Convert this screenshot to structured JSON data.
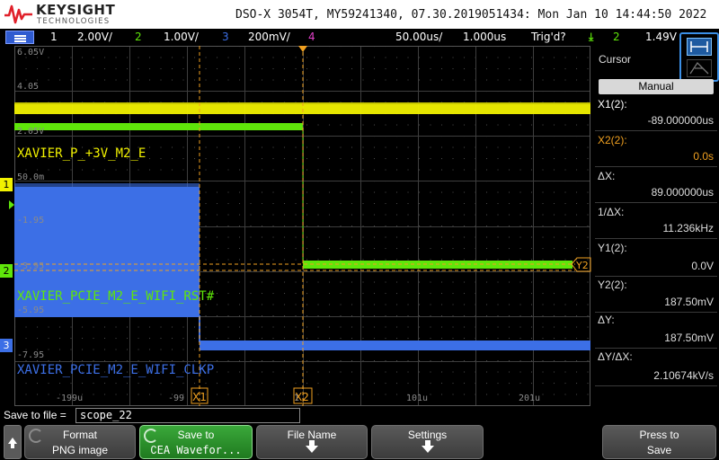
{
  "header": {
    "brand": "KEYSIGHT",
    "brand_sub": "TECHNOLOGIES",
    "instrument_line": "DSO-X 3054T, MY59241340, 07.30.2019051434: Mon Jan 10 14:44:50 2022"
  },
  "status_bar": {
    "ch1_num": "1",
    "ch1_scale": "2.00V/",
    "ch2_num": "2",
    "ch2_scale": "1.00V/",
    "ch3_num": "3",
    "ch3_scale": "200mV/",
    "ch4_num": "4",
    "timebase": "50.00us/",
    "delay": "1.000us",
    "trigger_state": "Trig'd?",
    "trigger_channel": "2",
    "trigger_level": "1.49V"
  },
  "waveforms": {
    "ch1_label": "XAVIER_P_+3V_M2_E",
    "ch2_label": "XAVIER_PCIE_M2_E_WIFI_RST#",
    "ch3_label": "XAVIER_PCIE_M2_E_WIFI_CLKP",
    "scale_labels": [
      "6.05V",
      "4.05",
      "2.05V",
      "50.0m",
      "-1.95",
      "-3.95",
      "-5.95",
      "-7.95"
    ],
    "time_labels": [
      "-199u",
      "-99",
      "1",
      "101u",
      "201u"
    ],
    "cursor_x1_tag": "X1",
    "cursor_x2_tag": "X2",
    "cursor_y2_tag": "Y2",
    "ch1_marker": "1",
    "ch2_marker": "2",
    "ch3_marker": "3"
  },
  "colors": {
    "ch1": "#f2f200",
    "ch2": "#5fe60a",
    "ch3": "#3c6fe6",
    "ch4": "#e040c8",
    "cursor": "#f0a020"
  },
  "cursor_panel": {
    "title": "Cursor",
    "mode_button": "Manual",
    "x1_label": "X1(2):",
    "x1_value": "-89.000000us",
    "x2_label": "X2(2):",
    "x2_value": "0.0s",
    "dx_label": "ΔX:",
    "dx_value": "89.000000us",
    "inv_dx_label": "1/ΔX:",
    "inv_dx_value": "11.236kHz",
    "y1_label": "Y1(2):",
    "y1_value": "0.0V",
    "y2_label": "Y2(2):",
    "y2_value": "187.50mV",
    "dy_label": "ΔY:",
    "dy_value": "187.50mV",
    "dydx_label": "ΔY/ΔX:",
    "dydx_value": "2.10674kV/s"
  },
  "save": {
    "label": "Save to file =",
    "filename": "scope_22"
  },
  "softkeys": {
    "format_l1": "Format",
    "format_l2": "PNG image",
    "save_to_l1": "Save to",
    "save_to_l2": "∁EA Wavefor...",
    "file_name": "File Name",
    "settings": "Settings",
    "press_l1": "Press to",
    "press_l2": "Save"
  }
}
